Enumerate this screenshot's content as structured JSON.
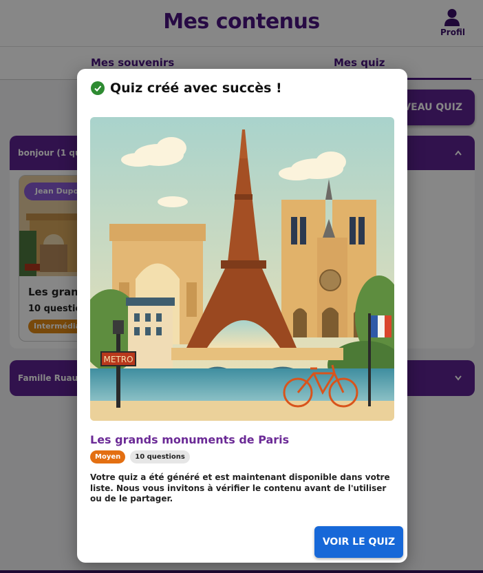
{
  "header": {
    "title": "Mes contenus",
    "profile_label": "Profil"
  },
  "tabs": [
    {
      "label": "Mes souvenirs"
    },
    {
      "label": "Mes quiz"
    }
  ],
  "new_quiz_button": "VEAU QUIZ",
  "groups": [
    {
      "label": "bonjour (1 quiz",
      "expanded": true
    },
    {
      "label": "Famille Ruault",
      "expanded": false
    }
  ],
  "card": {
    "author_badge": "Jean Dupon",
    "title": "Les grands",
    "questions": "10 question",
    "level": "Intermédiai"
  },
  "modal": {
    "title": "Quiz créé avec succès !",
    "quiz_title": "Les grands monuments de Paris",
    "level_tag": "Moyen",
    "questions_tag": "10 questions",
    "description": "Votre quiz a été généré et est maintenant disponible dans votre liste. Nous vous invitons à vérifier le contenu avant de l'utiliser ou de le partager.",
    "view_button": "VOIR LE QUIZ",
    "hero_sign": "METRO"
  },
  "colors": {
    "brand_purple": "#5d2391",
    "title_purple": "#4b1480",
    "success_green": "#2e8b32",
    "primary_blue": "#1768d8",
    "level_orange": "#e36f12"
  }
}
